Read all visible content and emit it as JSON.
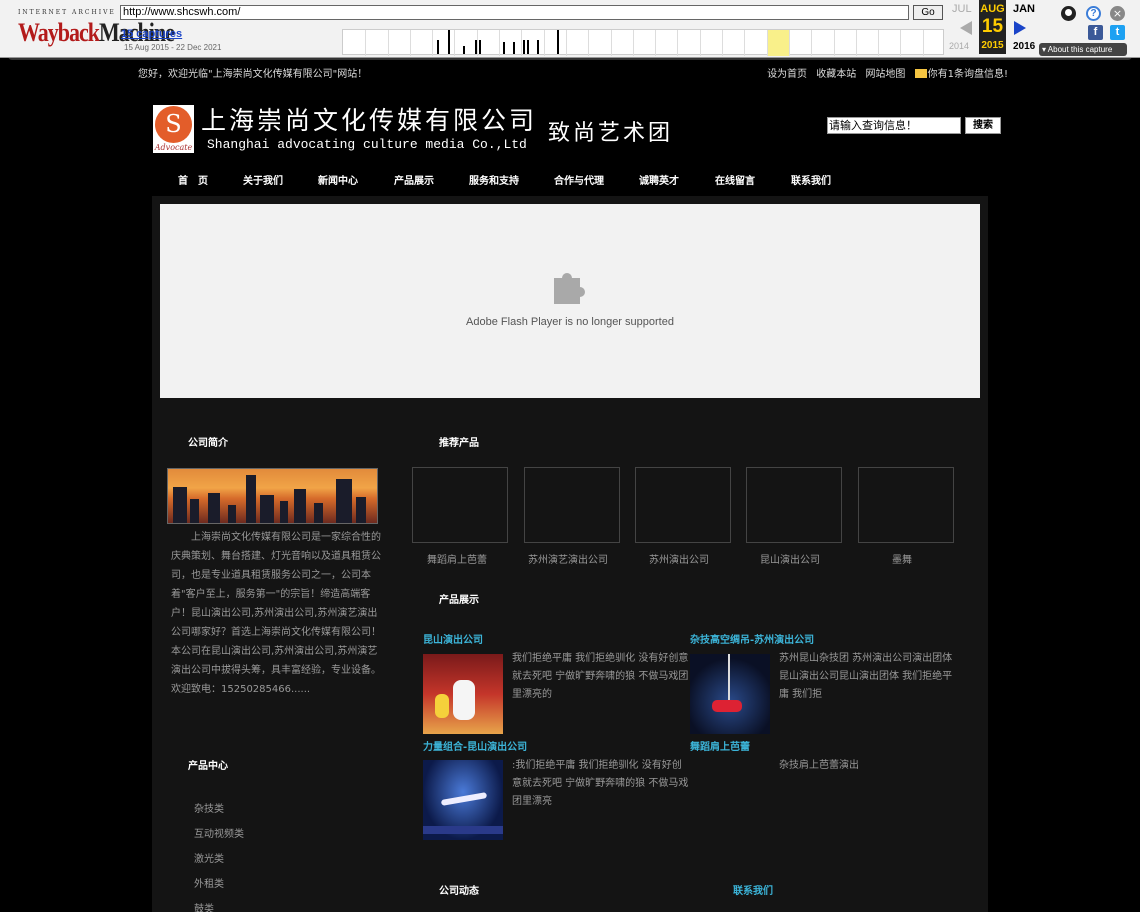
{
  "wayback": {
    "logo_top": "INTERNET ARCHIVE",
    "logo_a": "Wayback",
    "logo_b": "Machine",
    "url": "http://www.shcswh.com/",
    "go_label": "Go",
    "captures": "15 captures",
    "date_range": "15 Aug 2015 - 22 Dec 2021",
    "prev_month": "JUL",
    "cur_month": "AUG",
    "next_month": "JAN",
    "cur_day": "15",
    "prev_year": "2014",
    "cur_year": "2015",
    "next_year": "2016",
    "about": "About this capture",
    "icons": [
      "user-icon",
      "help-icon",
      "close-icon",
      "facebook-icon",
      "twitter-icon"
    ]
  },
  "topbar": {
    "welcome": "您好，欢迎光临\"上海崇尚文化传媒有限公司\"网站！",
    "links": [
      "设为首页",
      "收藏本站",
      "网站地图"
    ],
    "inquiry": "你有1条询盘信息!"
  },
  "header": {
    "logo_text": "Advocate",
    "company_cn": "上海崇尚文化传媒有限公司",
    "company_en": "Shanghai advocating culture media Co.,Ltd",
    "slogan": "致尚艺术团",
    "search_value": "请输入查询信息！",
    "search_btn": "搜索"
  },
  "nav": [
    "首　页",
    "关于我们",
    "新闻中心",
    "产品展示",
    "服务和支持",
    "合作与代理",
    "诚聘英才",
    "在线留言",
    "联系我们"
  ],
  "flash": {
    "message": "Adobe Flash Player is no longer supported"
  },
  "sidebar": {
    "intro_title": "公司简介",
    "intro_text": "上海崇尚文化传媒有限公司是一家综合性的庆典策划、舞台搭建、灯光音响以及道具租赁公司，也是专业道具租赁服务公司之一，公司本着\"客户至上，服务第一\"的宗旨！缔造高端客户！昆山演出公司,苏州演出公司,苏州演艺演出公司哪家好？首选上海崇尚文化传媒有限公司！本公司在昆山演出公司,苏州演出公司,苏州演艺演出公司中拔得头筹，具丰富经验，专业设备。欢迎致电：15250285466......",
    "products_title": "产品中心",
    "categories": [
      "杂技类",
      "互动视频类",
      "激光类",
      "外租类",
      "鼓类"
    ]
  },
  "main": {
    "recommended_title": "推荐产品",
    "recommended": [
      "舞蹈肩上芭蕾",
      "苏州演艺演出公司",
      "苏州演出公司",
      "昆山演出公司",
      "墨舞"
    ],
    "showcase_title": "产品展示",
    "showcase": [
      {
        "title": "昆山演出公司",
        "text": "我们拒绝平庸 我们拒绝驯化 没有好创意就去死吧 宁做旷野奔啸的狼 不做马戏团里漂亮的"
      },
      {
        "title": "杂技高空绸吊-苏州演出公司",
        "text": "苏州昆山杂技团 苏州演出公司演出团体 昆山演出公司昆山演出团体 我们拒绝平庸 我们拒"
      },
      {
        "title": "力量组合-昆山演出公司",
        "text": ":我们拒绝平庸 我们拒绝驯化 没有好创意就去死吧 宁做旷野奔啸的狼 不做马戏团里漂亮"
      },
      {
        "title": "舞蹈肩上芭蕾",
        "text": "杂技肩上芭蕾演出"
      }
    ],
    "news_title": "公司动态",
    "contact_title": "联系我们"
  }
}
